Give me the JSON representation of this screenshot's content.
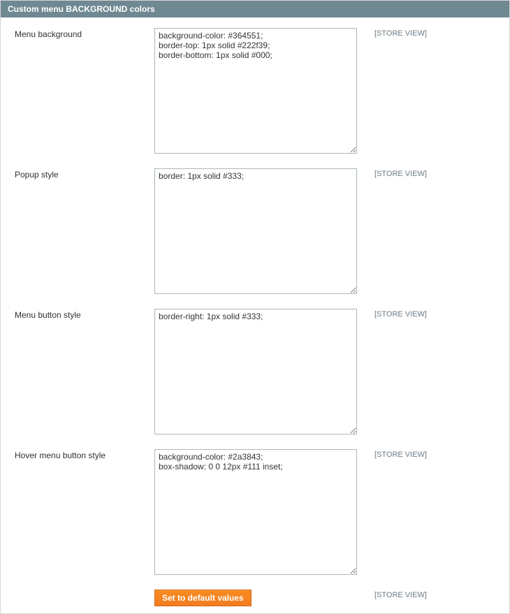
{
  "section": {
    "title": "Custom menu BACKGROUND colors"
  },
  "fields": {
    "menu_background": {
      "label": "Menu background",
      "value": "background-color: #364551;\nborder-top: 1px solid #222f39;\nborder-bottom: 1px solid #000;",
      "scope": "[STORE VIEW]"
    },
    "popup_style": {
      "label": "Popup style",
      "value": "border: 1px solid #333;",
      "scope": "[STORE VIEW]"
    },
    "menu_button_style": {
      "label": "Menu button style",
      "value": "border-right: 1px solid #333;",
      "scope": "[STORE VIEW]"
    },
    "hover_menu_button_style": {
      "label": "Hover menu button style",
      "value": "background-color: #2a3843;\nbox-shadow: 0 0 12px #111 inset;",
      "scope": "[STORE VIEW]"
    }
  },
  "actions": {
    "set_defaults": "Set to default values",
    "scope": "[STORE VIEW]"
  }
}
